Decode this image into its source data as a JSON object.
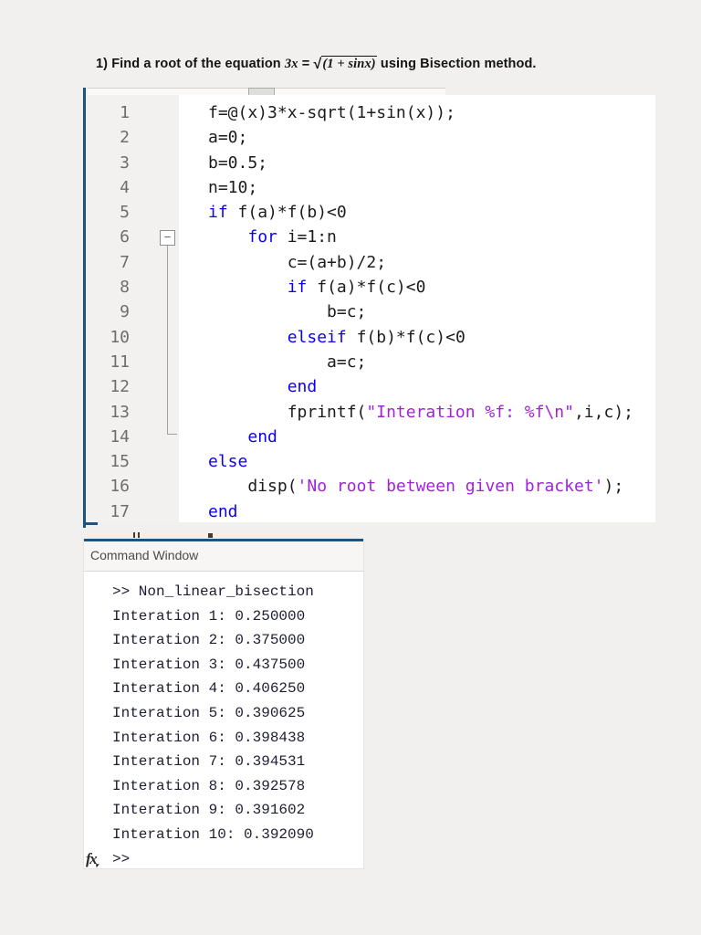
{
  "title": {
    "text_before_math": "1) Find a root of the equation ",
    "math_lhs": "3x",
    "math_eq": " = ",
    "math_radical": "√",
    "math_radicand": "(1 + sinx)",
    "text_after_math": " using Bisection method."
  },
  "editor": {
    "fold_icon": "−",
    "lines": [
      {
        "num": "1",
        "segments": [
          {
            "t": "f=@(x)3*x-sqrt(1+sin(x));",
            "c": "plain"
          }
        ]
      },
      {
        "num": "2",
        "segments": [
          {
            "t": "a=0;",
            "c": "plain"
          }
        ]
      },
      {
        "num": "3",
        "segments": [
          {
            "t": "b=0.5;",
            "c": "plain"
          }
        ]
      },
      {
        "num": "4",
        "segments": [
          {
            "t": "n=10;",
            "c": "plain"
          }
        ]
      },
      {
        "num": "5",
        "segments": [
          {
            "t": "if",
            "c": "kw"
          },
          {
            "t": " f(a)*f(b)<0",
            "c": "plain"
          }
        ]
      },
      {
        "num": "6",
        "segments": [
          {
            "t": "    ",
            "c": "plain"
          },
          {
            "t": "for",
            "c": "kw"
          },
          {
            "t": " i=1:n",
            "c": "plain"
          }
        ]
      },
      {
        "num": "7",
        "segments": [
          {
            "t": "        c=(a+b)/2;",
            "c": "plain"
          }
        ]
      },
      {
        "num": "8",
        "segments": [
          {
            "t": "        ",
            "c": "plain"
          },
          {
            "t": "if",
            "c": "kw"
          },
          {
            "t": " f(a)*f(c)<0",
            "c": "plain"
          }
        ]
      },
      {
        "num": "9",
        "segments": [
          {
            "t": "            b=c;",
            "c": "plain"
          }
        ]
      },
      {
        "num": "10",
        "segments": [
          {
            "t": "        ",
            "c": "plain"
          },
          {
            "t": "elseif",
            "c": "kw"
          },
          {
            "t": " f(b)*f(c)<0",
            "c": "plain"
          }
        ]
      },
      {
        "num": "11",
        "segments": [
          {
            "t": "            a=c;",
            "c": "plain"
          }
        ]
      },
      {
        "num": "12",
        "segments": [
          {
            "t": "        ",
            "c": "plain"
          },
          {
            "t": "end",
            "c": "kw"
          }
        ]
      },
      {
        "num": "13",
        "segments": [
          {
            "t": "        fprintf(",
            "c": "plain"
          },
          {
            "t": "\"Interation %f: %f\\n\"",
            "c": "str"
          },
          {
            "t": ",i,c);",
            "c": "plain"
          }
        ]
      },
      {
        "num": "14",
        "segments": [
          {
            "t": "    ",
            "c": "plain"
          },
          {
            "t": "end",
            "c": "kw"
          }
        ]
      },
      {
        "num": "15",
        "segments": [
          {
            "t": "else",
            "c": "kw"
          }
        ]
      },
      {
        "num": "16",
        "segments": [
          {
            "t": "    disp(",
            "c": "plain"
          },
          {
            "t": "'No root between given bracket'",
            "c": "str"
          },
          {
            "t": ");",
            "c": "plain"
          }
        ]
      },
      {
        "num": "17",
        "segments": [
          {
            "t": "end",
            "c": "kw"
          }
        ]
      }
    ]
  },
  "command_window": {
    "title": "Command Window",
    "lines": [
      ">> Non_linear_bisection",
      "Interation 1: 0.250000",
      "Interation 2: 0.375000",
      "Interation 3: 0.437500",
      "Interation 4: 0.406250",
      "Interation 5: 0.390625",
      "Interation 6: 0.398438",
      "Interation 7: 0.394531",
      "Interation 8: 0.392578",
      "Interation 9: 0.391602",
      "Interation 10: 0.392090"
    ],
    "fx_label": "fx",
    "caret_icon": "▾",
    "prompt": ">>"
  },
  "colors": {
    "page_bg": "#f1f0ee",
    "panel_blue": "#1d5380",
    "keyword": "#0d00f5",
    "string": "#a122dc",
    "code_text": "#1c1c1c",
    "line_number": "#6e6e6e",
    "command_text": "#1e1e32",
    "header_text": "#4b4b4b"
  }
}
